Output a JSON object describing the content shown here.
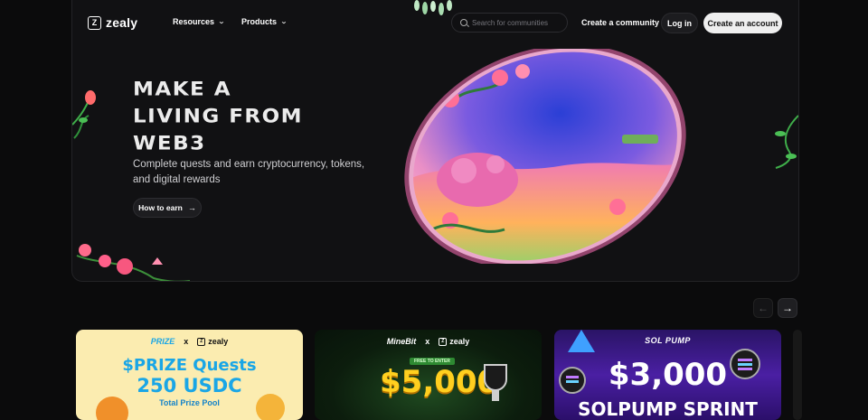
{
  "nav": {
    "logo_text": "zealy",
    "resources_label": "Resources",
    "products_label": "Products",
    "search_placeholder": "Search for communities",
    "create_community_label": "Create a community",
    "login_label": "Log in",
    "create_account_label": "Create an account"
  },
  "hero": {
    "headline_lines": [
      "MAKE A",
      "LIVING FROM",
      "WEB3"
    ],
    "subtitle": "Complete quests and earn cryptocurrency, tokens, and digital rewards",
    "cta_label": "How to earn"
  },
  "carousel": {
    "prev_icon": "arrow-left-icon",
    "next_icon": "arrow-right-icon",
    "cards": [
      {
        "brand": "PRIZE",
        "cross": "x",
        "partner": "zealy",
        "title": "$PRIZE Quests",
        "amount": "250 USDC",
        "sub": "Total Prize Pool"
      },
      {
        "brand": "MineBit",
        "cross": "x",
        "partner": "zealy",
        "badge": "FREE TO ENTER",
        "amount": "$5,000"
      },
      {
        "brand": "SOL PUMP",
        "amount": "$3,000",
        "sub": "SOLPUMP SPRINT"
      }
    ]
  },
  "colors": {
    "background": "#0b0b0c",
    "hero_bg": "#111113",
    "primary_button_bg": "#efefef",
    "card1_bg": "#fbecb0",
    "card1_text": "#1aa6e6",
    "card2_amount": "#ffcf1f",
    "card3_bg": "#4a1fa3"
  }
}
